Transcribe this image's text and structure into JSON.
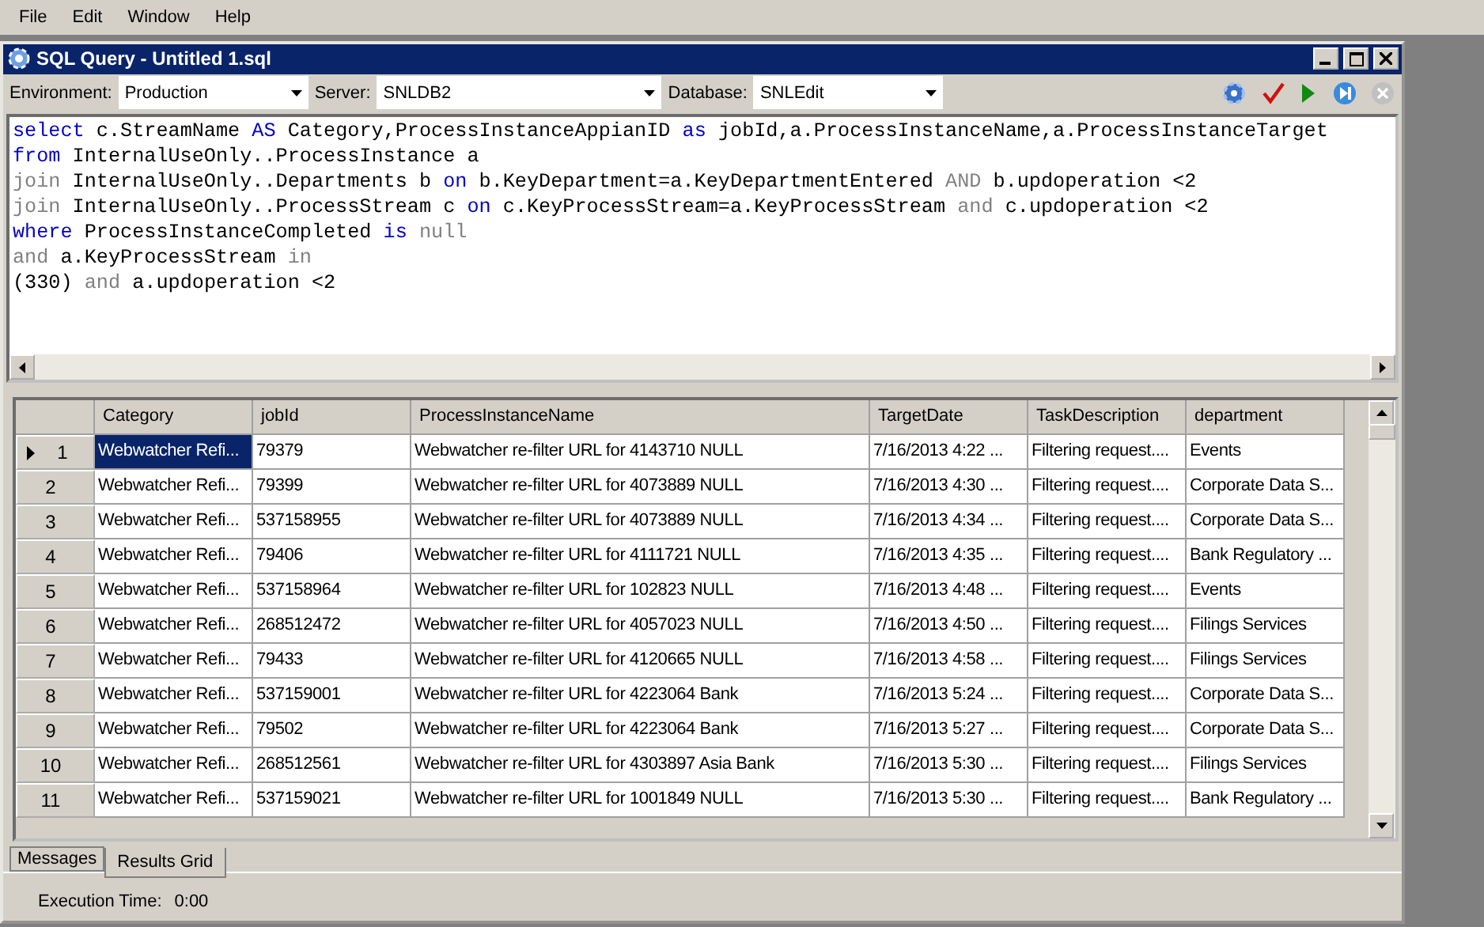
{
  "menu": [
    "File",
    "Edit",
    "Window",
    "Help"
  ],
  "window": {
    "title": "SQL Query - Untitled 1.sql"
  },
  "toolbar": {
    "fields": [
      {
        "label": "Environment:",
        "value": "Production"
      },
      {
        "label": "Server:",
        "value": "SNLDB2"
      },
      {
        "label": "Database:",
        "value": "SNLEdit"
      }
    ]
  },
  "editor": {
    "lines": [
      [
        {
          "kind": "kw",
          "text": "select"
        },
        {
          "kind": "text",
          "text": " c.StreamName "
        },
        {
          "kind": "kw",
          "text": "AS"
        },
        {
          "kind": "text",
          "text": " Category,ProcessInstanceAppianID "
        },
        {
          "kind": "kw",
          "text": "as"
        },
        {
          "kind": "text",
          "text": " jobId,a.ProcessInstanceName,a.ProcessInstanceTarget"
        }
      ],
      [
        {
          "kind": "kw",
          "text": "from"
        },
        {
          "kind": "text",
          "text": " InternalUseOnly..ProcessInstance a"
        }
      ],
      [
        {
          "kind": "op",
          "text": "join"
        },
        {
          "kind": "text",
          "text": " InternalUseOnly..Departments b "
        },
        {
          "kind": "kw",
          "text": "on"
        },
        {
          "kind": "text",
          "text": " b.KeyDepartment=a.KeyDepartmentEntered "
        },
        {
          "kind": "op",
          "text": "AND"
        },
        {
          "kind": "text",
          "text": " b.updoperation <2"
        }
      ],
      [
        {
          "kind": "op",
          "text": "join"
        },
        {
          "kind": "text",
          "text": " InternalUseOnly..ProcessStream c "
        },
        {
          "kind": "kw",
          "text": "on"
        },
        {
          "kind": "text",
          "text": " c.KeyProcessStream=a.KeyProcessStream "
        },
        {
          "kind": "op",
          "text": "and"
        },
        {
          "kind": "text",
          "text": " c.updoperation <2"
        }
      ],
      [
        {
          "kind": "kw",
          "text": "where"
        },
        {
          "kind": "text",
          "text": " ProcessInstanceCompleted "
        },
        {
          "kind": "kw",
          "text": "is"
        },
        {
          "kind": "op",
          "text": " null"
        }
      ],
      [
        {
          "kind": "op",
          "text": "and"
        },
        {
          "kind": "text",
          "text": " a.KeyProcessStream "
        },
        {
          "kind": "op",
          "text": "in"
        }
      ],
      [
        {
          "kind": "text",
          "text": "(330) "
        },
        {
          "kind": "op",
          "text": "and"
        },
        {
          "kind": "text",
          "text": " a.updoperation <2"
        }
      ]
    ]
  },
  "grid": {
    "columns": [
      "Category",
      "jobId",
      "ProcessInstanceName",
      "TargetDate",
      "TaskDescription",
      "department"
    ],
    "rows": [
      {
        "number": "1",
        "selected": true,
        "cells": [
          "Webwatcher Refi...",
          "79379",
          "Webwatcher re-filter URL for 4143710 NULL",
          "7/16/2013 4:22 ...",
          "Filtering request....",
          "Events"
        ]
      },
      {
        "number": "2",
        "selected": false,
        "cells": [
          "Webwatcher Refi...",
          "79399",
          "Webwatcher re-filter URL for 4073889 NULL",
          "7/16/2013 4:30 ...",
          "Filtering request....",
          "Corporate Data S..."
        ]
      },
      {
        "number": "3",
        "selected": false,
        "cells": [
          "Webwatcher Refi...",
          "537158955",
          "Webwatcher re-filter URL for 4073889 NULL",
          "7/16/2013 4:34 ...",
          "Filtering request....",
          "Corporate Data S..."
        ]
      },
      {
        "number": "4",
        "selected": false,
        "cells": [
          "Webwatcher Refi...",
          "79406",
          "Webwatcher re-filter URL for 4111721 NULL",
          "7/16/2013 4:35 ...",
          "Filtering request....",
          "Bank Regulatory ..."
        ]
      },
      {
        "number": "5",
        "selected": false,
        "cells": [
          "Webwatcher Refi...",
          "537158964",
          "Webwatcher re-filter URL for 102823 NULL",
          "7/16/2013 4:48 ...",
          "Filtering request....",
          "Events"
        ]
      },
      {
        "number": "6",
        "selected": false,
        "cells": [
          "Webwatcher Refi...",
          "268512472",
          "Webwatcher re-filter URL for 4057023 NULL",
          "7/16/2013 4:50 ...",
          "Filtering request....",
          "Filings Services"
        ]
      },
      {
        "number": "7",
        "selected": false,
        "cells": [
          "Webwatcher Refi...",
          "79433",
          "Webwatcher re-filter URL for 4120665 NULL",
          "7/16/2013 4:58 ...",
          "Filtering request....",
          "Filings Services"
        ]
      },
      {
        "number": "8",
        "selected": false,
        "cells": [
          "Webwatcher Refi...",
          "537159001",
          "Webwatcher re-filter URL for 4223064 Bank",
          "7/16/2013 5:24 ...",
          "Filtering request....",
          "Corporate Data S..."
        ]
      },
      {
        "number": "9",
        "selected": false,
        "cells": [
          "Webwatcher Refi...",
          "79502",
          "Webwatcher re-filter URL for 4223064 Bank",
          "7/16/2013 5:27 ...",
          "Filtering request....",
          "Corporate Data S..."
        ]
      },
      {
        "number": "10",
        "selected": false,
        "cells": [
          "Webwatcher Refi...",
          "268512561",
          "Webwatcher re-filter URL for 4303897 Asia Bank",
          "7/16/2013 5:30 ...",
          "Filtering request....",
          "Filings Services"
        ]
      },
      {
        "number": "11",
        "selected": false,
        "cells": [
          "Webwatcher Refi...",
          "537159021",
          "Webwatcher re-filter URL for 1001849 NULL",
          "7/16/2013 5:30 ...",
          "Filtering request....",
          "Bank Regulatory ..."
        ]
      }
    ]
  },
  "tabs": [
    {
      "label": "Messages",
      "selected": false
    },
    {
      "label": "Results Grid",
      "selected": true
    }
  ],
  "status_bar": {
    "label": "Execution Time:",
    "value": "0:00"
  }
}
